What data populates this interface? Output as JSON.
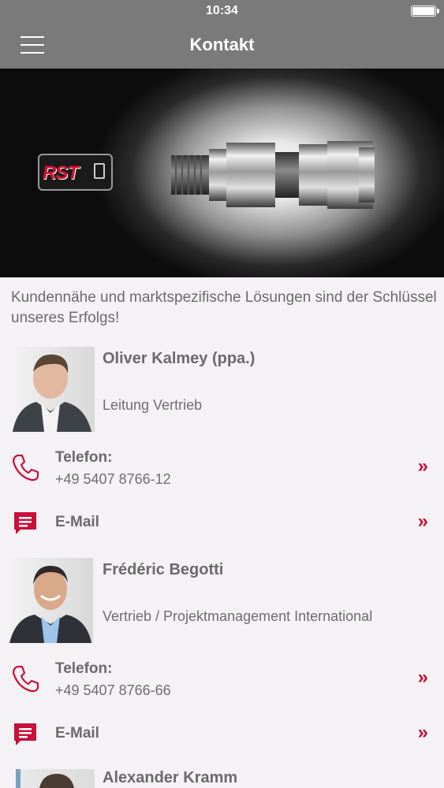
{
  "status_bar": {
    "time": "10:34",
    "battery_level": 1.0
  },
  "nav": {
    "title": "Kontakt",
    "menu_icon": "hamburger-menu-icon"
  },
  "hero": {
    "logo_text": "RST",
    "product": "cable-gland-fitting"
  },
  "intro": "Kundennähe und marktspezifische Lösungen sind der Schlüssel unseres Erfolgs!",
  "contacts": [
    {
      "name": "Oliver Kalmey (ppa.)",
      "role": "Leitung Vertrieb",
      "phone_label": "Telefon:",
      "phone": "+49 5407 8766-12",
      "email_label": "E-Mail",
      "chevron": "»"
    },
    {
      "name": "Frédéric Begotti",
      "role": "Vertrieb / Projektmanagement International",
      "phone_label": "Telefon:",
      "phone": "+49 5407 8766-66",
      "email_label": "E-Mail",
      "chevron": "»"
    },
    {
      "name": "Alexander Kramm"
    }
  ],
  "colors": {
    "accent": "#c8103a",
    "nav_bg": "#7a7a7a",
    "page_bg": "#f4f2f5",
    "text": "#6a6a6a"
  }
}
